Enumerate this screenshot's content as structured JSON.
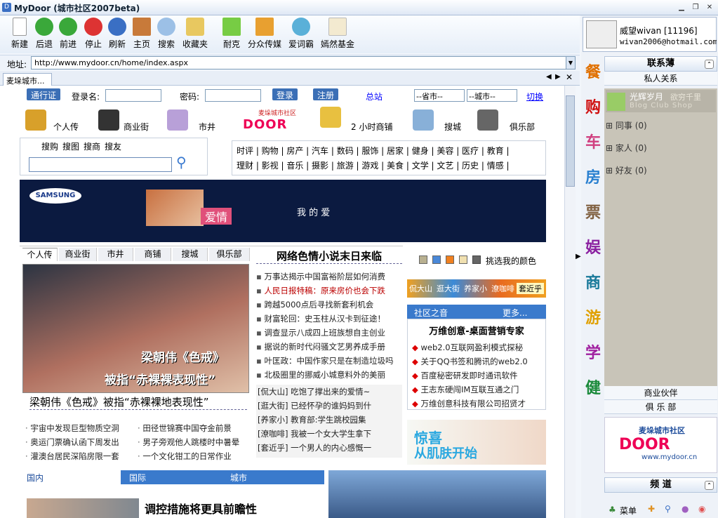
{
  "window": {
    "title": "MyDoor (城市社区2007beta)"
  },
  "toolbar": {
    "buttons": [
      "新建",
      "后退",
      "前进",
      "停止",
      "刷新",
      "主页",
      "搜索",
      "收藏夹",
      "耐克",
      "分众传媒",
      "爱词霸",
      "嫣然基金"
    ]
  },
  "address": {
    "label": "地址:",
    "url": "http://www.mydoor.cn/home/index.aspx"
  },
  "tab": {
    "label": "麦垛城市..."
  },
  "page": {
    "login": {
      "pass_label": "通行证",
      "user_label": "登录名:",
      "pwd_label": "密码:",
      "login_btn": "登录",
      "register_btn": "注册",
      "station": "总站",
      "province": "--省市--",
      "city": "--城市--",
      "switch": "切换"
    },
    "nav": [
      "个人传",
      "商业街",
      "市井",
      "2 小时商铺",
      "搜城",
      "俱乐部"
    ],
    "brand": {
      "text": "麦垛城市社区",
      "url": "www.mydoor.cn",
      "logo": "DOOR"
    },
    "search_tabs": [
      "搜购",
      "搜图",
      "搜商",
      "搜友"
    ],
    "categories_row1": "时评 | 购物 | 房产 | 汽车 | 数码 | 服饰 | 居家 | 健身 | 美容 | 医疗 | 教育 |",
    "categories_row2": "理财 | 影视 | 音乐 | 摄影 | 旅游 | 游戏 | 美食 | 文学 | 文艺 | 历史 | 情感 |",
    "ad": {
      "brand": "SAMSUNG",
      "tag": "爱情",
      "text": "我 的 爱"
    },
    "subtabs": [
      "个人传",
      "商业街",
      "市井",
      "商铺",
      "搜城",
      "俱乐部"
    ],
    "feature": {
      "title": "梁朝伟《色戒》被指“赤裸裸地表现性”",
      "img_line1": "梁朝伟《色戒》",
      "img_line2": "被指“赤裸裸表现性”"
    },
    "headline": "网络色情小说末日来临",
    "news": [
      {
        "t": "万事达揭示中国富裕阶层如何消费",
        "red": false
      },
      {
        "t": "人民日报特稿：原来房价也会下跌",
        "red": true
      },
      {
        "t": "跨越5000点后寻找新套利机会",
        "red": false
      },
      {
        "t": "财富轮回：史玉柱从汉卡到征途！",
        "red": false
      },
      {
        "t": "调查显示八成四上班族想自主创业",
        "red": false
      },
      {
        "t": "据说的新时代闷骚文艺男养成手册",
        "red": false
      },
      {
        "t": "叶匡政：中国作家只是在制造垃圾吗",
        "red": false
      },
      {
        "t": "北极圈里的挪威小城意料外的美丽",
        "red": false
      }
    ],
    "bracket_news": [
      {
        "tag": "[侃大山]",
        "t": "吃饱了撑出来的爱情~"
      },
      {
        "tag": "[逛大街]",
        "t": "已经怀孕的谁妈妈到什"
      },
      {
        "tag": "[养家小]",
        "t": "教育部:学生跳校园集"
      },
      {
        "tag": "[潦咖啡]",
        "t": "我被一个女大学生拿下"
      },
      {
        "tag": "[套近乎]",
        "t": "一个男人的内心感慨一"
      }
    ],
    "left_list": [
      "宇宙中发现巨型物质空洞",
      "奥运门票确认函下周发出",
      "灌澳台居民深陷房限一套"
    ],
    "left_list2": [
      "田径世锦赛中国夺金前景",
      "男子旁观他人跳楼时中暑晕",
      "一个文化钳工的日常作业"
    ],
    "color_pick": "挑选我的颜色",
    "color_tabs": [
      "侃大山",
      "逛大街",
      "养家小",
      "潦咖啡",
      "套近乎"
    ],
    "community": {
      "title": "社区之音",
      "more": "更多...",
      "headline": "万维创意-桌面营销专家",
      "items": [
        "web2.0互联网盈利模式探秘",
        "关于QQ书签和腾讯的web2.0",
        "百度秘密研发即时通讯软件",
        "王志东硬闯IM互联互通之门",
        "万维创意科技有限公司招贤才"
      ]
    },
    "ad2": {
      "line1": "惊喜",
      "line2": "从肌肤开始"
    },
    "bottom_tabs": [
      "国内",
      "国际",
      "城市"
    ],
    "bottom_headline": "调控措施将更具前瞻性"
  },
  "right": {
    "user": {
      "name": "威望wivan [11196]",
      "email": "wivan2006@hotmail.com"
    },
    "categories": [
      "餐",
      "购",
      "车",
      "房",
      "票",
      "娱",
      "商",
      "游",
      "学",
      "健"
    ],
    "contacts_title": "联系薄",
    "private": "私人关系",
    "featured_contact": {
      "name": "光辉岁月",
      "note": "欲穷千里",
      "sub": "Blog Club Shop"
    },
    "groups": [
      "同事 (0)",
      "家人 (0)",
      "好友 (0)"
    ],
    "partner": "商业伙伴",
    "club": "俱 乐 部",
    "logo_text": "麦垛城市社区",
    "logo_url": "www.mydoor.cn",
    "channel": "频 道",
    "menu": "菜单"
  }
}
